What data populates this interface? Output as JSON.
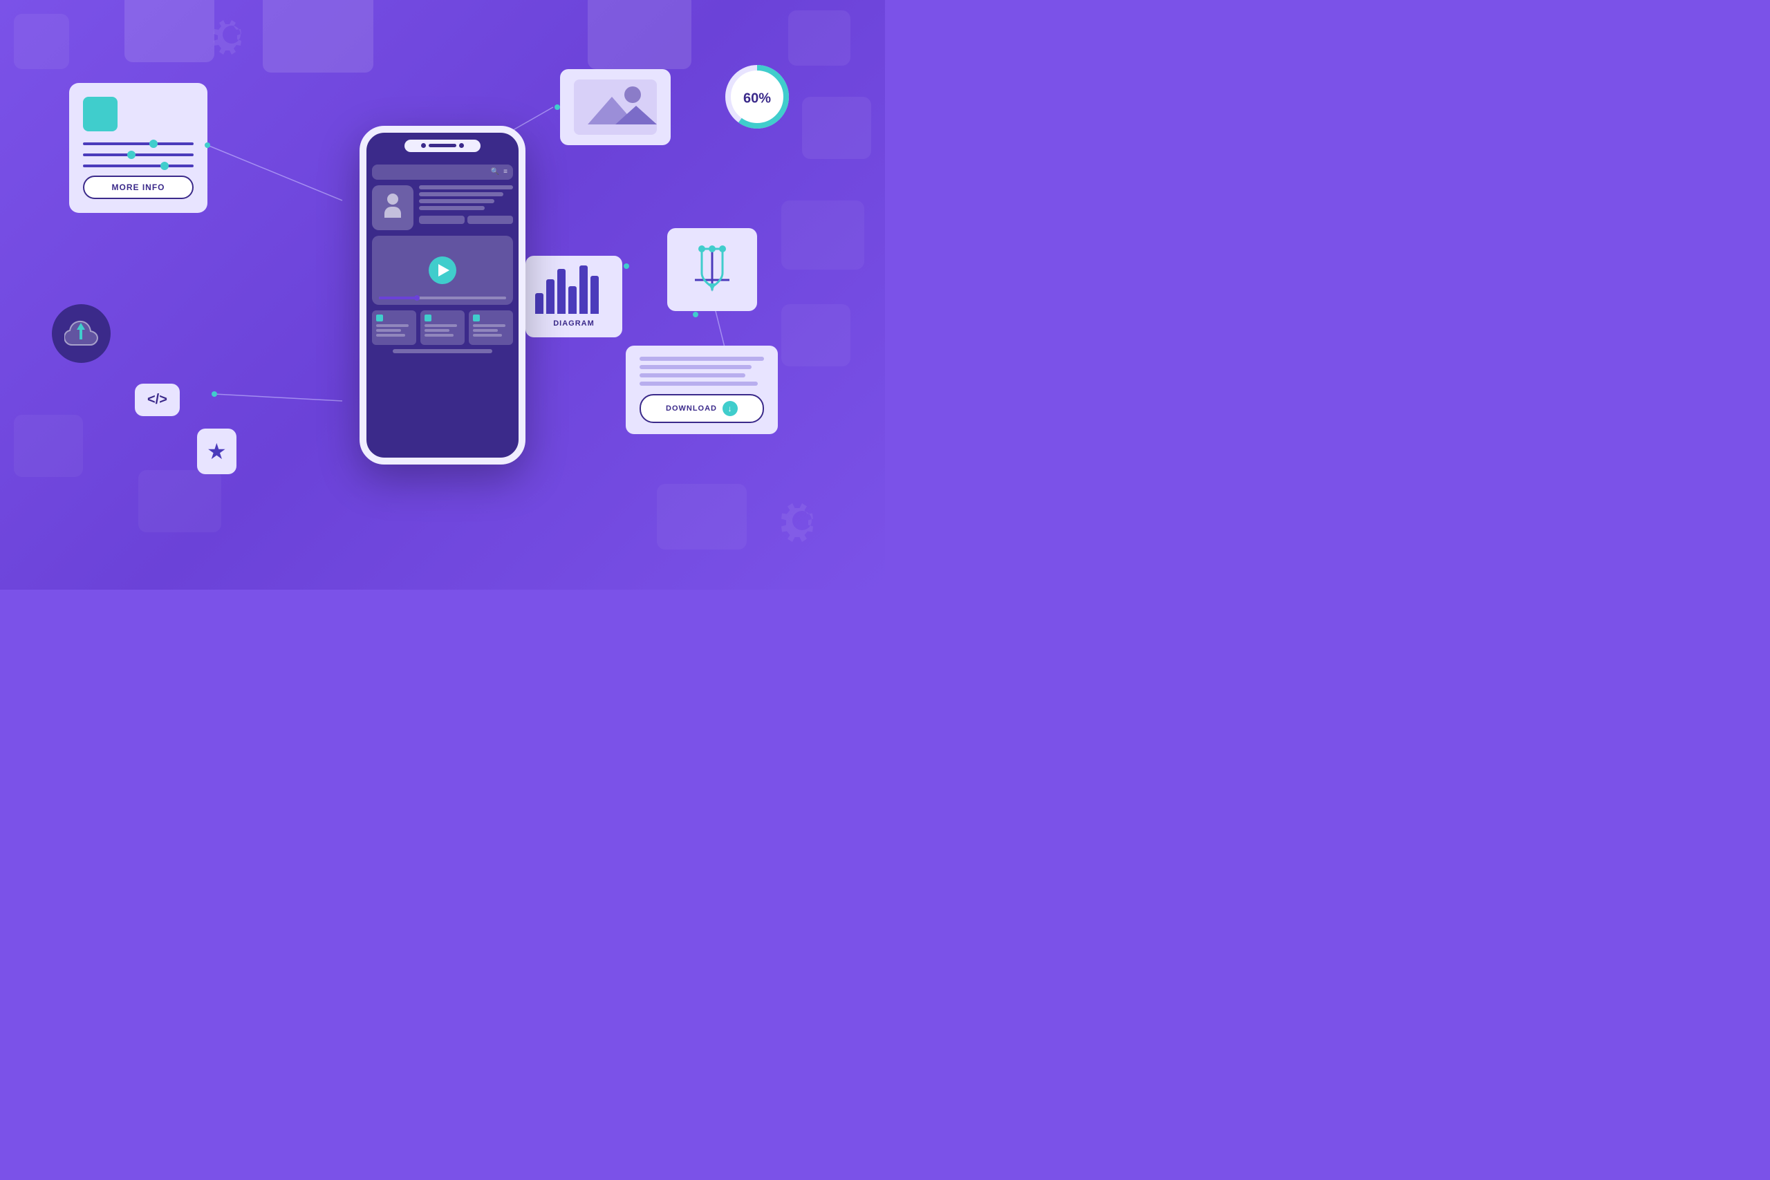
{
  "background": {
    "color": "#7B52E8"
  },
  "phone": {
    "search_placeholder": "",
    "search_icon": "🔍",
    "menu_icon": "≡"
  },
  "cards": {
    "settings": {
      "color_block": "#40CDCC",
      "sliders": [
        {
          "position": 60
        },
        {
          "position": 40
        },
        {
          "position": 70
        }
      ],
      "more_info_label": "MORE INFO"
    },
    "diagram": {
      "label": "DIAGRAM",
      "bars": [
        30,
        55,
        70,
        45,
        80,
        60
      ]
    },
    "download": {
      "button_label": "DOWNLOAD"
    },
    "progress": {
      "value": 60,
      "label": "60%"
    },
    "code": {
      "symbol": "</>"
    }
  }
}
